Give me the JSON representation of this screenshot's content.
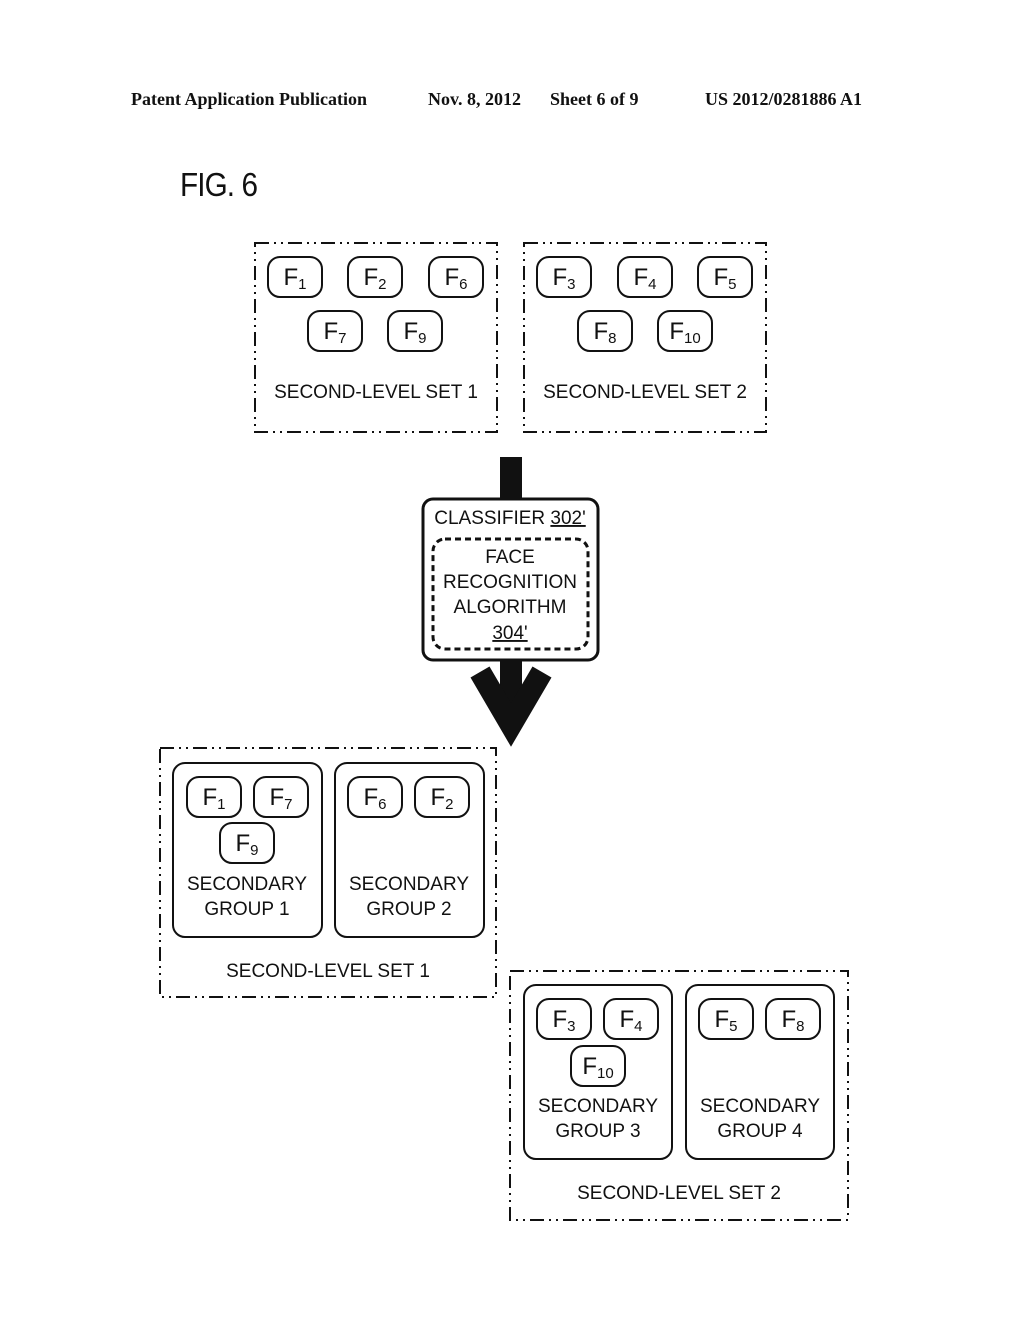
{
  "header": {
    "publication": "Patent Application Publication",
    "date": "Nov. 8, 2012",
    "sheet": "Sheet 6 of 9",
    "number": "US 2012/0281886 A1"
  },
  "figure_label": "FIG. 6",
  "input_sets": [
    {
      "label": "SECOND-LEVEL SET 1",
      "faces": [
        {
          "letter": "F",
          "sub": "1"
        },
        {
          "letter": "F",
          "sub": "2"
        },
        {
          "letter": "F",
          "sub": "6"
        },
        {
          "letter": "F",
          "sub": "7"
        },
        {
          "letter": "F",
          "sub": "9"
        }
      ]
    },
    {
      "label": "SECOND-LEVEL SET 2",
      "faces": [
        {
          "letter": "F",
          "sub": "3"
        },
        {
          "letter": "F",
          "sub": "4"
        },
        {
          "letter": "F",
          "sub": "5"
        },
        {
          "letter": "F",
          "sub": "8"
        },
        {
          "letter": "F",
          "sub": "10"
        }
      ]
    }
  ],
  "classifier": {
    "label": "CLASSIFIER ",
    "ref": "302'",
    "algorithm_lines": [
      "FACE",
      "RECOGNITION",
      "ALGORITHM"
    ],
    "algorithm_ref": "304'"
  },
  "output_sets": [
    {
      "label": "SECOND-LEVEL SET 1",
      "groups": [
        {
          "line1": "SECONDARY",
          "line2": "GROUP 1",
          "faces": [
            {
              "letter": "F",
              "sub": "1"
            },
            {
              "letter": "F",
              "sub": "7"
            },
            {
              "letter": "F",
              "sub": "9"
            }
          ]
        },
        {
          "line1": "SECONDARY",
          "line2": "GROUP 2",
          "faces": [
            {
              "letter": "F",
              "sub": "6"
            },
            {
              "letter": "F",
              "sub": "2"
            }
          ]
        }
      ]
    },
    {
      "label": "SECOND-LEVEL SET 2",
      "groups": [
        {
          "line1": "SECONDARY",
          "line2": "GROUP 3",
          "faces": [
            {
              "letter": "F",
              "sub": "3"
            },
            {
              "letter": "F",
              "sub": "4"
            },
            {
              "letter": "F",
              "sub": "10"
            }
          ]
        },
        {
          "line1": "SECONDARY",
          "line2": "GROUP 4",
          "faces": [
            {
              "letter": "F",
              "sub": "5"
            },
            {
              "letter": "F",
              "sub": "8"
            }
          ]
        }
      ]
    }
  ]
}
